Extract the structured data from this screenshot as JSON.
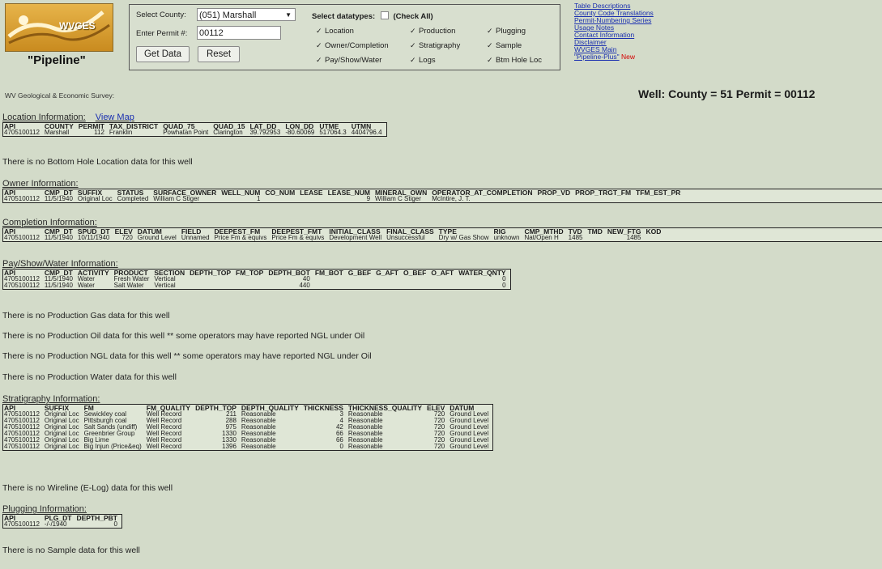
{
  "header": {
    "logo_text": "WVGES",
    "logo_name": "\"Pipeline\"",
    "select_county_label": "Select County:",
    "county_value": "(051) Marshall",
    "permit_label": "Enter Permit #:",
    "permit_value": "00112",
    "get_data": "Get Data",
    "reset": "Reset",
    "datatypes_label": "Select datatypes:",
    "check_all": "(Check All)",
    "checkboxes": [
      "Location",
      "Production",
      "Plugging",
      "Owner/Completion",
      "Stratigraphy",
      "Sample",
      "Pay/Show/Water",
      "Logs",
      "Btm Hole Loc"
    ],
    "links": [
      "Table Descriptions",
      "County Code Translations",
      "Permit-Numbering Series",
      "Usage Notes",
      "Contact Information",
      "Disclaimer",
      "WVGES Main",
      "\"Pipeline-Plus\""
    ],
    "new_label": "New",
    "survey": "WV Geological & Economic Survey:",
    "well_title": "Well:   County = 51 Permit = 00112"
  },
  "location": {
    "title": "Location Information:",
    "map_link": "View Map",
    "columns": [
      "API",
      "COUNTY",
      "PERMIT",
      "TAX_DISTRICT",
      "QUAD_75",
      "QUAD_15",
      "LAT_DD",
      "LON_DD",
      "UTME",
      "UTMN"
    ],
    "rows": [
      [
        "4705100112",
        "Marshall",
        "112",
        "Franklin",
        "Powhatan Point",
        "Clarington",
        "39.792953",
        "-80.60069",
        "517064.3",
        "4404796.4"
      ]
    ]
  },
  "msg_bottom_hole": "There is no Bottom Hole Location data for this well",
  "owner": {
    "title": "Owner Information:",
    "columns": [
      "API",
      "CMP_DT",
      "SUFFIX",
      "STATUS",
      "SURFACE_OWNER",
      "WELL_NUM",
      "CO_NUM",
      "LEASE",
      "LEASE_NUM",
      "MINERAL_OWN",
      "OPERATOR_AT_COMPLETION",
      "PROP_VD",
      "PROP_TRGT_FM",
      "TFM_EST_PR"
    ],
    "rows": [
      [
        "4705100112",
        "11/5/1940",
        "Original Loc",
        "Completed",
        "William C Stiger",
        "1",
        "",
        "",
        "9",
        "William C Stiger",
        "McIntire, J. T.",
        "",
        "",
        ""
      ]
    ]
  },
  "completion": {
    "title": "Completion Information:",
    "columns": [
      "API",
      "CMP_DT",
      "SPUD_DT",
      "ELEV",
      "DATUM",
      "FIELD",
      "DEEPEST_FM",
      "DEEPEST_FMT",
      "INITIAL_CLASS",
      "FINAL_CLASS",
      "TYPE",
      "RIG",
      "CMP_MTHD",
      "TVD",
      "TMD",
      "NEW_FTG",
      "KOD"
    ],
    "rows": [
      [
        "4705100112",
        "11/5/1940",
        "10/11/1940",
        "720",
        "Ground Level",
        "Unnamed",
        "Price Fm & equivs",
        "Price Fm & equivs",
        "Development Well",
        "Unsuccessful",
        "Dry w/ Gas Show",
        "unknown",
        "Nat/Open H",
        "1485",
        "",
        "1485",
        ""
      ]
    ]
  },
  "pay": {
    "title": "Pay/Show/Water Information:",
    "columns": [
      "API",
      "CMP_DT",
      "ACTIVITY",
      "PRODUCT",
      "SECTION",
      "DEPTH_TOP",
      "FM_TOP",
      "DEPTH_BOT",
      "FM_BOT",
      "G_BEF",
      "G_AFT",
      "O_BEF",
      "O_AFT",
      "WATER_QNTY"
    ],
    "rows": [
      [
        "4705100112",
        "11/5/1940",
        "Water",
        "Fresh Water",
        "Vertical",
        "",
        "",
        "40",
        "",
        "",
        "",
        "",
        "",
        "0"
      ],
      [
        "4705100112",
        "11/5/1940",
        "Water",
        "Salt Water",
        "Vertical",
        "",
        "",
        "440",
        "",
        "",
        "",
        "",
        "",
        "0"
      ]
    ]
  },
  "msg_gas": "There is no Production Gas data for this well",
  "msg_oil": "There is no Production Oil data for this well    ** some operators may have reported NGL under Oil",
  "msg_ngl": "There is no Production NGL data for this well    ** some operators may have reported NGL under Oil",
  "msg_water": "There is no Production Water data for this well",
  "strat": {
    "title": "Stratigraphy Information:",
    "columns": [
      "API",
      "SUFFIX",
      "FM",
      "FM_QUALITY",
      "DEPTH_TOP",
      "DEPTH_QUALITY",
      "THICKNESS",
      "THICKNESS_QUALITY",
      "ELEV",
      "DATUM"
    ],
    "rows": [
      [
        "4705100112",
        "Original Loc",
        "Sewickley coal",
        "Well Record",
        "211",
        "Reasonable",
        "3",
        "Reasonable",
        "720",
        "Ground Level"
      ],
      [
        "4705100112",
        "Original Loc",
        "Pittsburgh coal",
        "Well Record",
        "288",
        "Reasonable",
        "4",
        "Reasonable",
        "720",
        "Ground Level"
      ],
      [
        "4705100112",
        "Original Loc",
        "Salt Sands (undiff)",
        "Well Record",
        "975",
        "Reasonable",
        "42",
        "Reasonable",
        "720",
        "Ground Level"
      ],
      [
        "4705100112",
        "Original Loc",
        "Greenbrier Group",
        "Well Record",
        "1330",
        "Reasonable",
        "66",
        "Reasonable",
        "720",
        "Ground Level"
      ],
      [
        "4705100112",
        "Original Loc",
        "Big Lime",
        "Well Record",
        "1330",
        "Reasonable",
        "66",
        "Reasonable",
        "720",
        "Ground Level"
      ],
      [
        "4705100112",
        "Original Loc",
        "Big Injun (Price&eq)",
        "Well Record",
        "1396",
        "Reasonable",
        "0",
        "Reasonable",
        "720",
        "Ground Level"
      ]
    ]
  },
  "msg_wireline": "There is no Wireline (E-Log) data for this well",
  "plugging": {
    "title": "Plugging Information:",
    "columns": [
      "API",
      "PLG_DT",
      "DEPTH_PBT"
    ],
    "rows": [
      [
        "4705100112",
        "-/-/1940",
        "0"
      ]
    ]
  },
  "msg_sample": "There is no Sample data for this well"
}
